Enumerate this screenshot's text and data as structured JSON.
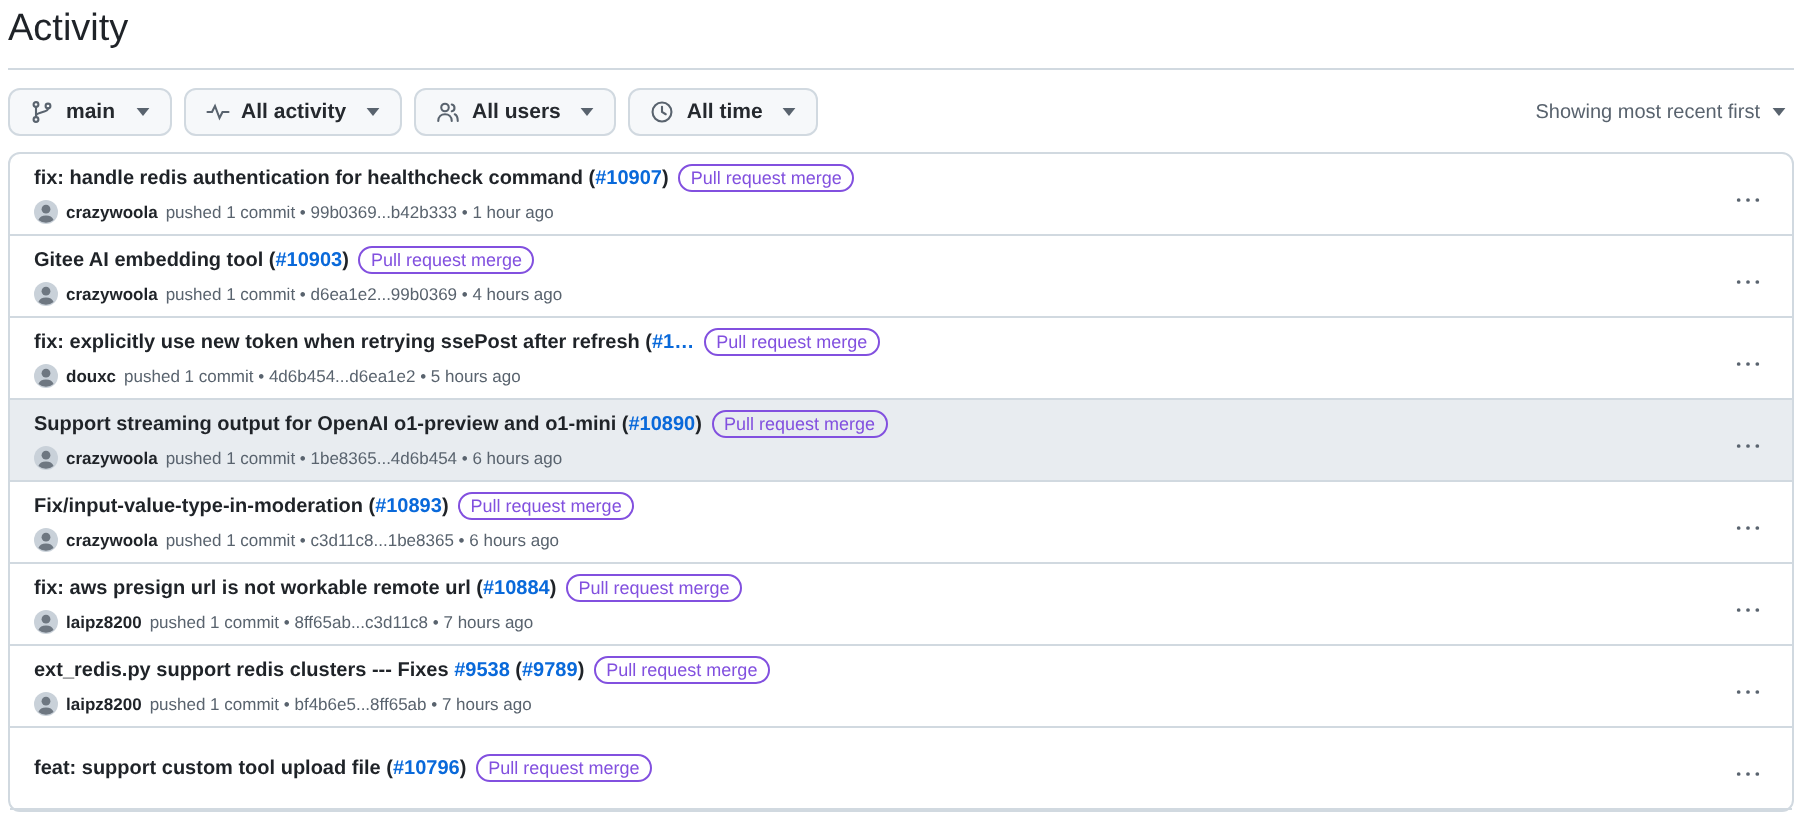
{
  "heading": "Activity",
  "filters": [
    {
      "kind": "branch",
      "label": "main"
    },
    {
      "kind": "activity",
      "label": "All activity"
    },
    {
      "kind": "users",
      "label": "All users"
    },
    {
      "kind": "time",
      "label": "All time"
    }
  ],
  "sort": {
    "label": "Showing most recent first"
  },
  "rows": [
    {
      "hovered": false,
      "title": [
        {
          "kind": "text",
          "text": "fix: handle redis authentication for healthcheck command ("
        },
        {
          "kind": "link",
          "text": "#10907"
        },
        {
          "kind": "text",
          "text": ")"
        }
      ],
      "badge": "Pull request merge",
      "user": "crazywoola",
      "detail": "pushed 1 commit • 99b0369...b42b333 • 1 hour ago"
    },
    {
      "hovered": false,
      "title": [
        {
          "kind": "text",
          "text": "Gitee AI embedding tool ("
        },
        {
          "kind": "link",
          "text": "#10903"
        },
        {
          "kind": "text",
          "text": ")"
        }
      ],
      "badge": "Pull request merge",
      "user": "crazywoola",
      "detail": "pushed 1 commit • d6ea1e2...99b0369 • 4 hours ago"
    },
    {
      "hovered": false,
      "title": [
        {
          "kind": "text",
          "text": "fix: explicitly use new token when retrying ssePost after refresh ("
        },
        {
          "kind": "link",
          "text": "#1…"
        }
      ],
      "badge": "Pull request merge",
      "user": "douxc",
      "detail": "pushed 1 commit • 4d6b454...d6ea1e2 • 5 hours ago"
    },
    {
      "hovered": true,
      "title": [
        {
          "kind": "text",
          "text": "Support streaming output for OpenAI o1-preview and o1-mini ("
        },
        {
          "kind": "link",
          "text": "#10890"
        },
        {
          "kind": "text",
          "text": ")"
        }
      ],
      "badge": "Pull request merge",
      "user": "crazywoola",
      "detail": "pushed 1 commit • 1be8365...4d6b454 • 6 hours ago"
    },
    {
      "hovered": false,
      "title": [
        {
          "kind": "text",
          "text": "Fix/input-value-type-in-moderation ("
        },
        {
          "kind": "link",
          "text": "#10893"
        },
        {
          "kind": "text",
          "text": ")"
        }
      ],
      "badge": "Pull request merge",
      "user": "crazywoola",
      "detail": "pushed 1 commit • c3d11c8...1be8365 • 6 hours ago"
    },
    {
      "hovered": false,
      "title": [
        {
          "kind": "text",
          "text": "fix: aws presign url is not workable remote url ("
        },
        {
          "kind": "link",
          "text": "#10884"
        },
        {
          "kind": "text",
          "text": ")"
        }
      ],
      "badge": "Pull request merge",
      "user": "laipz8200",
      "detail": "pushed 1 commit • 8ff65ab...c3d11c8 • 7 hours ago"
    },
    {
      "hovered": false,
      "title": [
        {
          "kind": "text",
          "text": "ext_redis.py support redis clusters --- Fixes "
        },
        {
          "kind": "link",
          "text": "#9538"
        },
        {
          "kind": "text",
          "text": " ("
        },
        {
          "kind": "link",
          "text": "#9789"
        },
        {
          "kind": "text",
          "text": ")"
        }
      ],
      "badge": "Pull request merge",
      "user": "laipz8200",
      "detail": "pushed 1 commit • bf4b6e5...8ff65ab • 7 hours ago"
    },
    {
      "hovered": false,
      "title": [
        {
          "kind": "text",
          "text": "feat: support custom tool upload file ("
        },
        {
          "kind": "link",
          "text": "#10796"
        },
        {
          "kind": "text",
          "text": ")"
        }
      ],
      "badge": "Pull request merge"
    }
  ]
}
